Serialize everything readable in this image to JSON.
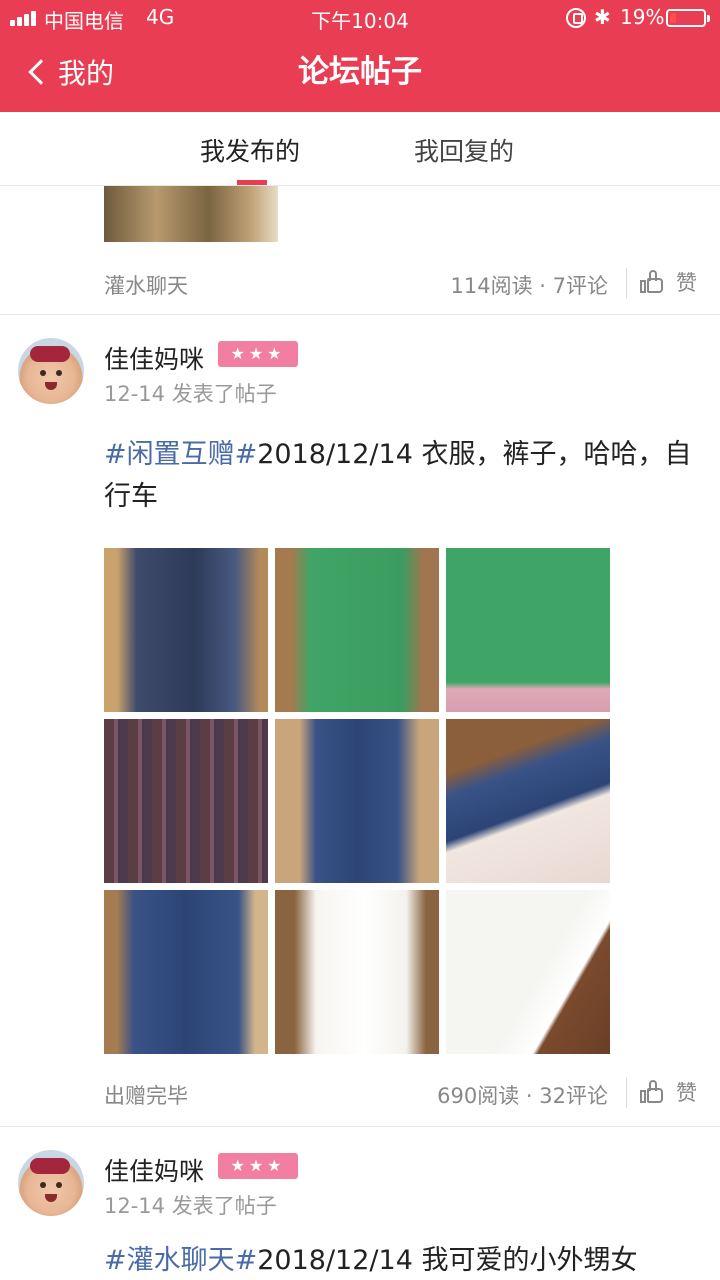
{
  "status_bar": {
    "carrier": "中国电信",
    "network": "4G",
    "time": "下午10:04",
    "battery": "19%",
    "battery_level": 0.19
  },
  "nav": {
    "back_label": "我的",
    "title": "论坛帖子"
  },
  "tabs": [
    {
      "label": "我发布的",
      "active": true
    },
    {
      "label": "我回复的",
      "active": false
    }
  ],
  "posts": [
    {
      "category": "灌水聊天",
      "stats": "114阅读 · 7评论",
      "like_label": "赞"
    },
    {
      "author": "佳佳妈咪",
      "badge": "★★★",
      "posted": "12-14 发表了帖子",
      "tag": "#闲置互赠#",
      "text": "2018/12/14  衣服，裤子，哈哈，自行车",
      "images": [
        "denim-dress-photo",
        "green-zip-hoodie-photo",
        "green-hoodie-back-photo",
        "plaid-shirt-photo",
        "blue-jeans-photo",
        "jeans-cuff-photo",
        "jeans-back-photo",
        "white-tshirt-photo",
        "white-sleeve-photo"
      ],
      "category": "出赠完毕",
      "stats": "690阅读 · 32评论",
      "like_label": "赞"
    },
    {
      "author": "佳佳妈咪",
      "badge": "★★★",
      "posted": "12-14 发表了帖子",
      "tag": "#灌水聊天#",
      "text": "2018/12/14 我可爱的小外甥女"
    }
  ],
  "colors": {
    "brand": "#e83d53",
    "tag": "#4a6aa8",
    "badge": "#f27fa2"
  }
}
